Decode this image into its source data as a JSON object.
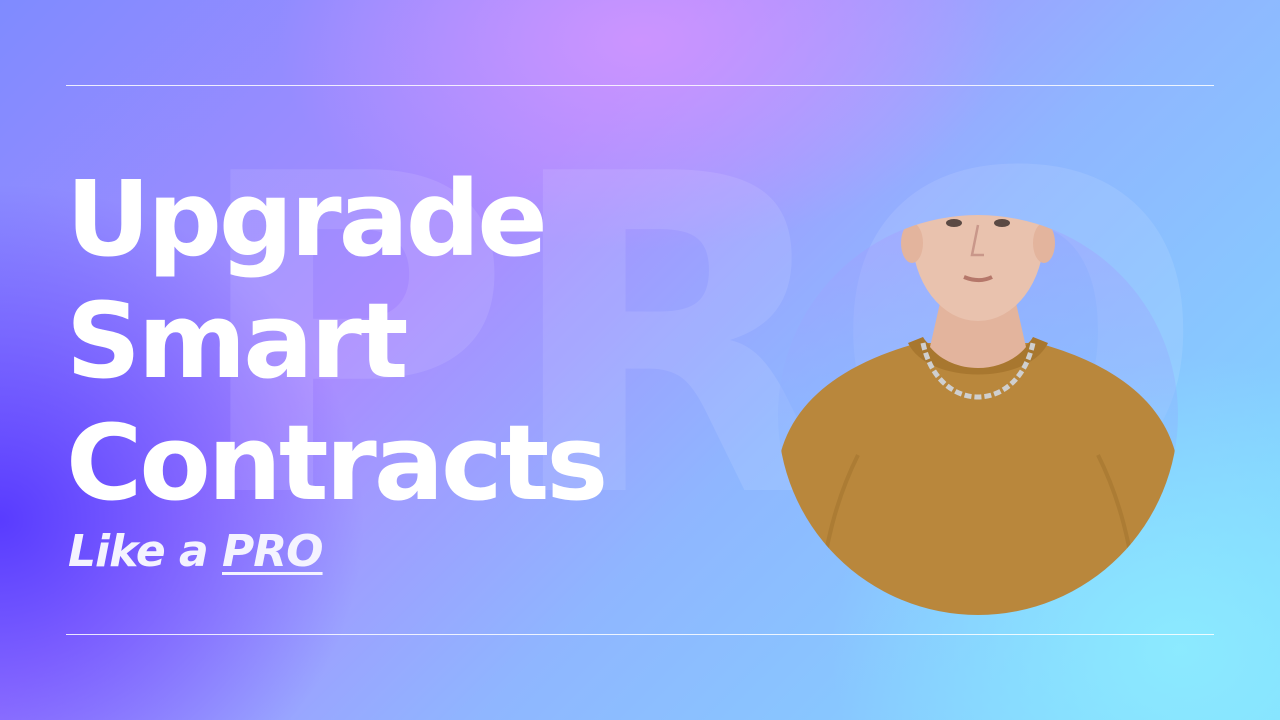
{
  "headline": {
    "line1": "Upgrade",
    "line2": "Smart",
    "line3": "Contracts"
  },
  "tagline": {
    "prefix": "Like a",
    "emphasis": "PRO"
  },
  "watermark_text": "PRO",
  "photo": {
    "subject": "presenter-portrait",
    "sweater_color": "#b9873c",
    "skin_color": "#e9c2ae"
  },
  "colors": {
    "gradient_violet": "#5537ff",
    "gradient_lilac": "#c89bff",
    "gradient_cyan": "#8fe6ff",
    "text": "#ffffff",
    "rule": "#ffffff"
  }
}
